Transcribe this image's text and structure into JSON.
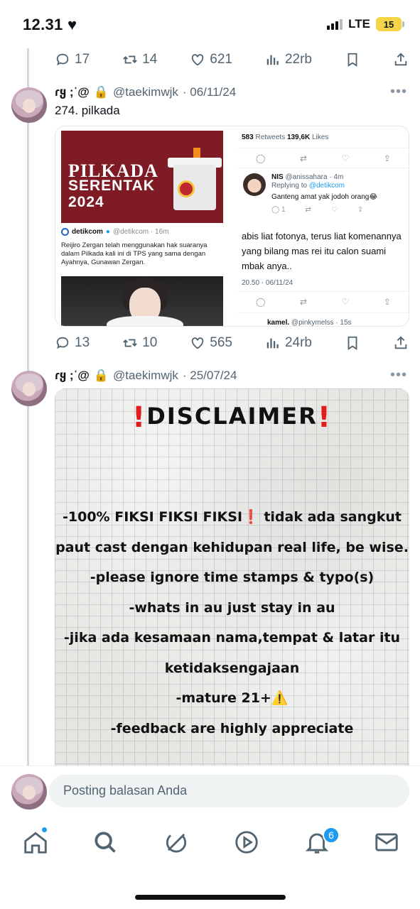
{
  "status_bar": {
    "time": "12.31",
    "network": "LTE",
    "battery": "15"
  },
  "top_actions": {
    "replies": "17",
    "reposts": "14",
    "likes": "621",
    "views": "22rb"
  },
  "tweet1": {
    "name": "ɾყ ;ʿ@",
    "handle": "@taekimwjk",
    "date": "· 06/11/24",
    "more": "•••",
    "text": "274. pilkada",
    "media": {
      "banner_title": "PILKADA",
      "banner_sub1": "SERENTAK",
      "banner_sub2": "2024",
      "detik_name": "detikcom",
      "detik_meta": "@detikcom · 16m",
      "detik_text": "Reijiro Zergan telah menggunakan hak suaranya dalam Pilkada kali ini di TPS yang sama dengan Ayahnya, Gunawan Zergan.",
      "stats_retweets": "583",
      "stats_retweets_label": "Retweets",
      "stats_likes": "139,6K",
      "stats_likes_label": "Likes",
      "reply_name": "NIS",
      "reply_handle": "@anissahara · 4m",
      "reply_to": "Replying to",
      "reply_to_link": "@detikcom",
      "reply_text": "Ganteng amat yak jodoh orang😂",
      "reply_count": "1",
      "main_text": "abis liat fotonya, terus liat komenannya yang bilang mas rei itu calon suami mbak anya..",
      "timestamp": "20.50 · 06/11/24",
      "next_name": "kamel.",
      "next_handle": "@pinkymelss · 15s"
    },
    "actions": {
      "replies": "13",
      "reposts": "10",
      "likes": "565",
      "views": "24rb"
    }
  },
  "tweet2": {
    "name": "ɾყ ;ʿ@",
    "handle": "@taekimwjk",
    "date": "· 25/07/24",
    "more": "•••",
    "disclaimer_title": "DISCLAIMER",
    "lines": {
      "l1": "-100% FIKSI FIKSI FIKSI",
      "l1b": "tidak ada sangkut",
      "l2": "paut cast dengan kehidupan real life, be wise.",
      "l3": "-please ignore time stamps & typo(s)",
      "l4": "-whats in au just stay in au",
      "l5": "-jika ada kesamaan nama,tempat & latar itu",
      "l6": "ketidaksengajaan",
      "l7": "-mature 21+⚠️",
      "l8": "-feedback are highly appreciate"
    }
  },
  "reply_bar": {
    "placeholder": "Posting balasan Anda"
  },
  "bottom_nav": {
    "notifications_badge": "6"
  },
  "colors": {
    "accent": "#1d9bf0",
    "muted": "#536471",
    "alert_red": "#e21b1b"
  }
}
